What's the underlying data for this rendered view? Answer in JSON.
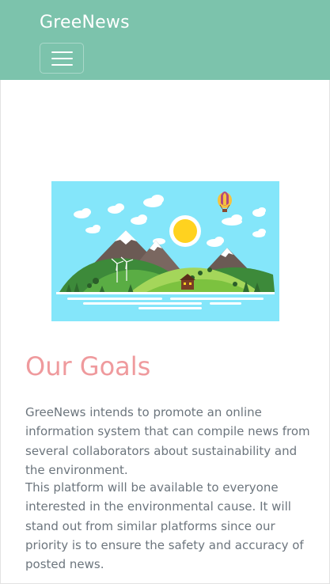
{
  "navbar": {
    "brand": "GreeNews",
    "toggler_icon": "hamburger-icon",
    "background_color": "#7cc3ac"
  },
  "hero": {
    "image_icon": "island-landscape-illustration",
    "sky_color": "#84e6fa"
  },
  "goals": {
    "title": "Our Goals",
    "title_color": "#ef9a9d",
    "paragraph_1": "GreeNews intends to promote an online information system that can compile news from several collaborators about sustainability and the environment.",
    "paragraph_2": "This platform will be available to everyone interested in the environmental cause. It will stand out from similar platforms since our priority is to ensure the safety and accuracy of posted news."
  }
}
